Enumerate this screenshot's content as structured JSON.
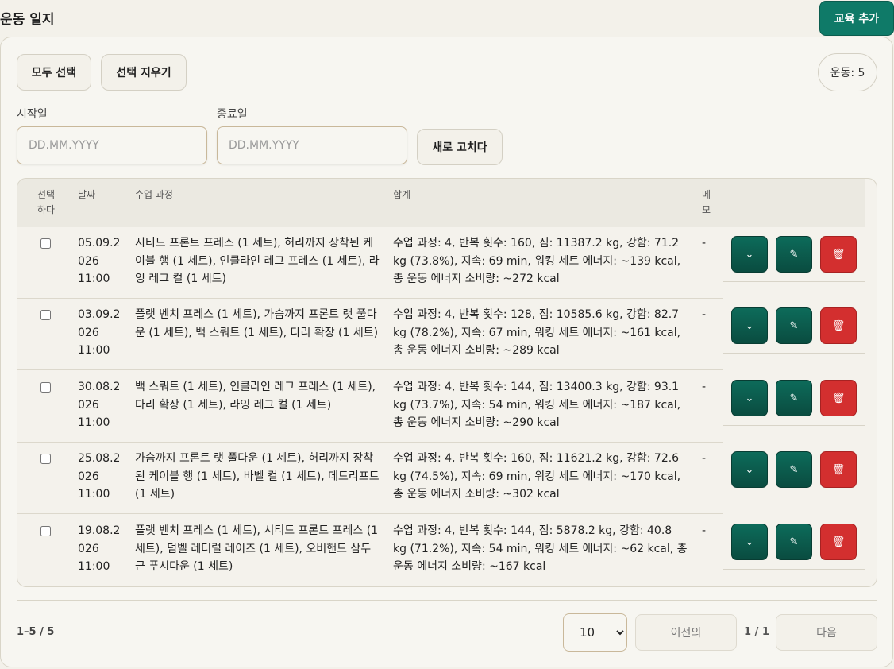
{
  "header": {
    "title": "운동 일지",
    "add_button": "교육 추가",
    "accent_color": "#0f7a68"
  },
  "toolbar": {
    "select_all": "모두 선택",
    "clear_selection": "선택 지우기",
    "count_label": "운동: 5"
  },
  "filters": {
    "start_label": "시작일",
    "start_placeholder": "DD.MM.YYYY",
    "end_label": "종료일",
    "end_placeholder": "DD.MM.YYYY",
    "refresh": "새로 고치다"
  },
  "table": {
    "headers": {
      "select_line1": "선택",
      "select_line2": "하다",
      "date": "날짜",
      "course": "수업 과정",
      "total": "합계",
      "memo_line1": "메",
      "memo_line2": "모"
    },
    "rows": [
      {
        "date_l1": "05.09.2",
        "date_l2": "026",
        "date_l3": "11:00",
        "course": "시티드 프론트 프레스 (1 세트), 허리까지 장착된 케이블 행 (1 세트), 인클라인 레그 프레스 (1 세트), 라잉 레그 컬 (1 세트)",
        "total": "수업 과정: 4, 반복 횟수: 160, 짐: 11387.2 kg, 강함: 71.2 kg (73.8%), 지속: 69 min, 워킹 세트 에너지: ~139 kcal, 총 운동 에너지 소비량: ~272 kcal",
        "memo": "-"
      },
      {
        "date_l1": "03.09.2",
        "date_l2": "026",
        "date_l3": "11:00",
        "course": "플랫 벤치 프레스 (1 세트), 가슴까지 프론트 랫 풀다운 (1 세트), 백 스쿼트 (1 세트), 다리 확장 (1 세트)",
        "total": "수업 과정: 4, 반복 횟수: 128, 짐: 10585.6 kg, 강함: 82.7 kg (78.2%), 지속: 67 min, 워킹 세트 에너지: ~161 kcal, 총 운동 에너지 소비량: ~289 kcal",
        "memo": "-"
      },
      {
        "date_l1": "30.08.2",
        "date_l2": "026",
        "date_l3": "11:00",
        "course": "백 스쿼트 (1 세트), 인클라인 레그 프레스 (1 세트), 다리 확장 (1 세트), 라잉 레그 컬 (1 세트)",
        "total": "수업 과정: 4, 반복 횟수: 144, 짐: 13400.3 kg, 강함: 93.1 kg (73.7%), 지속: 54 min, 워킹 세트 에너지: ~187 kcal, 총 운동 에너지 소비량: ~290 kcal",
        "memo": "-"
      },
      {
        "date_l1": "25.08.2",
        "date_l2": "026",
        "date_l3": "11:00",
        "course": "가슴까지 프론트 랫 풀다운 (1 세트), 허리까지 장착된 케이블 행 (1 세트), 바벨 컬 (1 세트), 데드리프트 (1 세트)",
        "total": "수업 과정: 4, 반복 횟수: 160, 짐: 11621.2 kg, 강함: 72.6 kg (74.5%), 지속: 69 min, 워킹 세트 에너지: ~170 kcal, 총 운동 에너지 소비량: ~302 kcal",
        "memo": "-"
      },
      {
        "date_l1": "19.08.2",
        "date_l2": "026",
        "date_l3": "11:00",
        "course": "플랫 벤치 프레스 (1 세트), 시티드 프론트 프레스 (1 세트), 덤벨 레터럴 레이즈 (1 세트), 오버핸드 삼두근 푸시다운 (1 세트)",
        "total": "수업 과정: 4, 반복 횟수: 144, 짐: 5878.2 kg, 강함: 40.8 kg (71.2%), 지속: 54 min, 워킹 세트 에너지: ~62 kcal, 총 운동 에너지 소비량: ~167 kcal",
        "memo": "-"
      }
    ],
    "row_actions": {
      "expand_glyph": "⌄",
      "edit_glyph": "✎",
      "delete_glyph": "🗑",
      "delete_color": "#d32f2f"
    }
  },
  "pagination": {
    "range": "1–5 / 5",
    "page_size": "10",
    "prev": "이전의",
    "page_info": "1 / 1",
    "next": "다음"
  }
}
